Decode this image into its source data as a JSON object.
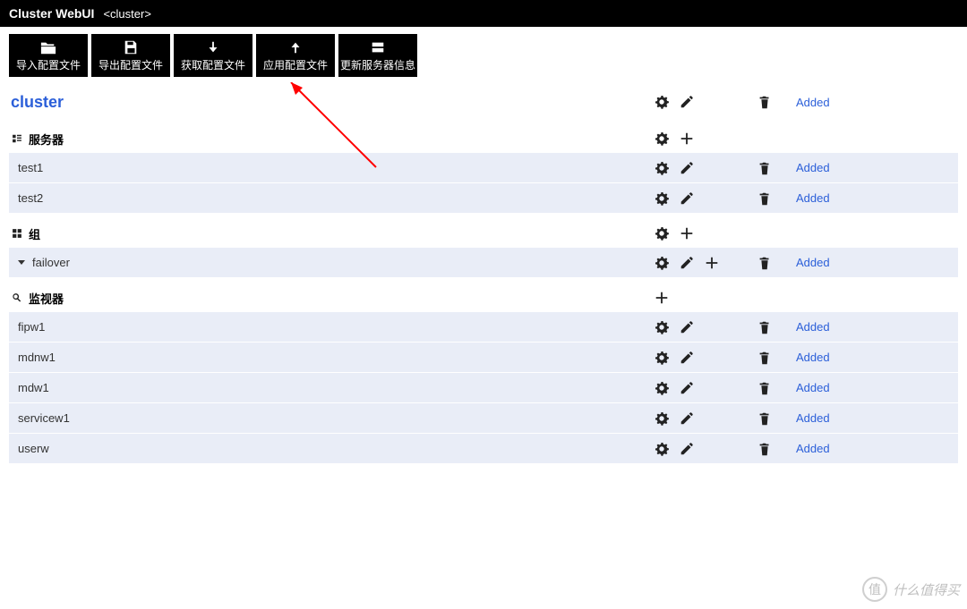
{
  "header": {
    "title": "Cluster WebUI",
    "subtitle": "<cluster>"
  },
  "toolbar": {
    "import": "导入配置文件",
    "export": "导出配置文件",
    "get": "获取配置文件",
    "apply": "应用配置文件",
    "update": "更新服务器信息"
  },
  "cluster": {
    "name": "cluster",
    "status": "Added"
  },
  "sections": {
    "servers": {
      "label": "服务器",
      "items": [
        {
          "name": "test1",
          "status": "Added"
        },
        {
          "name": "test2",
          "status": "Added"
        }
      ]
    },
    "groups": {
      "label": "组",
      "items": [
        {
          "name": "failover",
          "status": "Added",
          "expandable": true,
          "has_add": true
        }
      ]
    },
    "monitors": {
      "label": "监视器",
      "items": [
        {
          "name": "fipw1",
          "status": "Added"
        },
        {
          "name": "mdnw1",
          "status": "Added"
        },
        {
          "name": "mdw1",
          "status": "Added"
        },
        {
          "name": "servicew1",
          "status": "Added"
        },
        {
          "name": "userw",
          "status": "Added"
        }
      ]
    }
  },
  "watermark": "什么值得买"
}
